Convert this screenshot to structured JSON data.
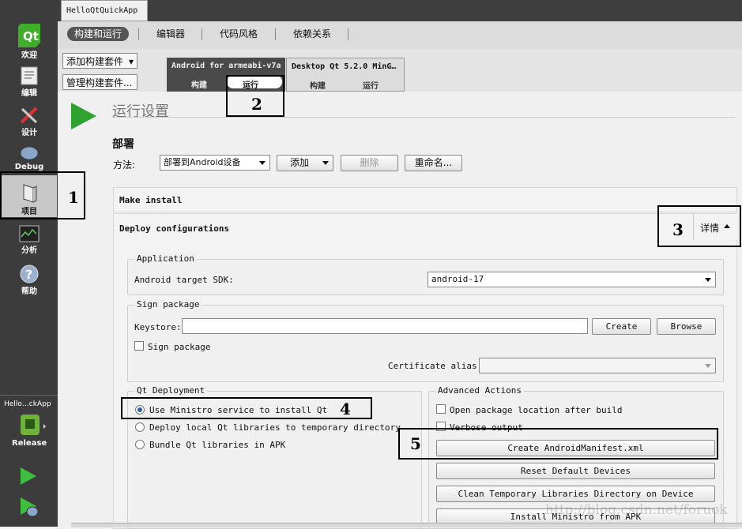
{
  "window": {
    "doc_tab": "HelloQtQuickApp"
  },
  "subtabs": [
    "构建和运行",
    "编辑器",
    "代码风格",
    "依赖关系"
  ],
  "modes": [
    {
      "label": "欢迎",
      "icon": "qt-logo-icon"
    },
    {
      "label": "编辑",
      "icon": "edit-document-icon"
    },
    {
      "label": "设计",
      "icon": "design-icon"
    },
    {
      "label": "Debug",
      "icon": "debug-icon"
    },
    {
      "label": "项目",
      "icon": "projects-icon"
    },
    {
      "label": "分析",
      "icon": "analyze-icon"
    },
    {
      "label": "帮助",
      "icon": "help-icon"
    }
  ],
  "target": {
    "project": "Hello…ckApp",
    "config": "Release"
  },
  "kits": {
    "add_label": "添加构建套件",
    "manage_label": "管理构建套件...",
    "android": {
      "name": "Android for armeabi-v7a",
      "build": "构建",
      "run": "运行"
    },
    "desktop": {
      "name": "Desktop Qt 5.2.0 MinG…",
      "build": "构建",
      "run": "运行"
    }
  },
  "run_settings": {
    "title": "运行设置",
    "deploy_heading": "部署",
    "method_label": "方法:",
    "method_value": "部署到Android设备",
    "add_label": "添加",
    "delete_label": "删除",
    "rename_label": "重命名..."
  },
  "sections": {
    "make_install": "Make install",
    "deploy_configs": "Deploy configurations",
    "details_label": "详情"
  },
  "application": {
    "title": "Application",
    "sdk_label": "Android target SDK:",
    "sdk_value": "android-17"
  },
  "sign": {
    "title": "Sign package",
    "keystore_label": "Keystore:",
    "keystore_value": "",
    "create_label": "Create",
    "browse_label": "Browse",
    "sign_checkbox": "Sign package",
    "alias_label": "Certificate alias:",
    "alias_value": ""
  },
  "qt_deploy": {
    "title": "Qt Deployment",
    "options": [
      "Use Ministro service to install Qt",
      "Deploy local Qt libraries to temporary directory",
      "Bundle Qt libraries in APK"
    ],
    "selected": 0
  },
  "advanced": {
    "title": "Advanced Actions",
    "open_pkg": "Open package location after build",
    "verbose": "Verbose output",
    "buttons": [
      "Create AndroidManifest.xml",
      "Reset Default Devices",
      "Clean Temporary Libraries Directory on Device",
      "Install Ministro from APK"
    ]
  },
  "callouts": [
    "1",
    "2",
    "3",
    "4",
    "5"
  ],
  "watermark": "http://blog.csdn.net/foruok",
  "colors": {
    "modebar": "#3c3c3c",
    "accent_green": "#2fa32f",
    "callout": "#000000"
  }
}
